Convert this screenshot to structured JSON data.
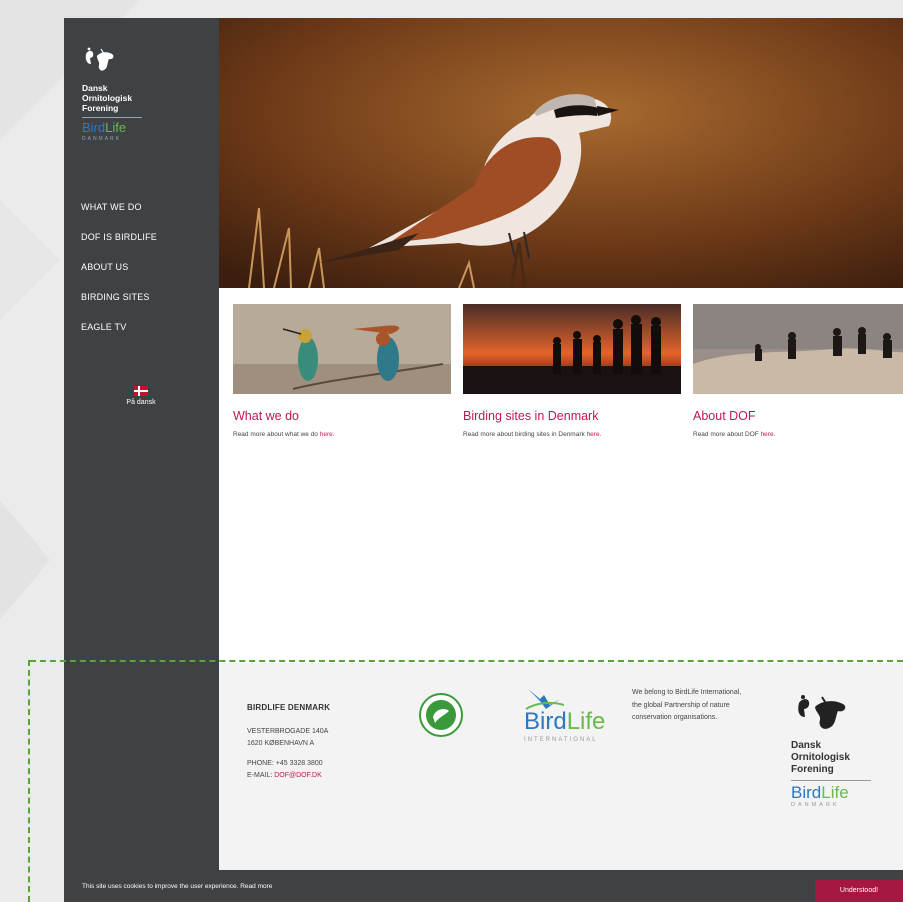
{
  "sidebar": {
    "logo": {
      "org_line1": "Dansk",
      "org_line2": "Ornitologisk",
      "org_line3": "Forening",
      "birdlife_a": "Bird",
      "birdlife_b": "Life",
      "birdlife_sub": "DANMARK"
    },
    "nav": [
      {
        "label": "WHAT WE DO"
      },
      {
        "label": "DOF IS BIRDLIFE"
      },
      {
        "label": "ABOUT US"
      },
      {
        "label": "BIRDING SITES"
      },
      {
        "label": "EAGLE TV"
      }
    ],
    "language": {
      "label": "På dansk",
      "icon": "danish-flag-icon"
    }
  },
  "hero": {
    "image": "red-backed-shrike-photo"
  },
  "cards": [
    {
      "title": "What we do",
      "text": "Read more about what we do ",
      "link": "here.",
      "image": "bee-eaters-photo"
    },
    {
      "title": "Birding sites in Denmark",
      "text": "Read more about birding sites in Denmark ",
      "link": "here.",
      "image": "birders-sunset-photo"
    },
    {
      "title": "About DOF",
      "text": "Read more about DOF ",
      "link": "here.",
      "image": "birders-dunes-photo"
    }
  ],
  "footer": {
    "heading": "BIRDLIFE DENMARK",
    "address1": "VESTERBROGADE 140A",
    "address2": "1620 KØBENHAVN A",
    "phone": "PHONE: +45 3328 3800",
    "email_label": "E-MAIL: ",
    "email": "DOF@DOF.DK",
    "birdlife_intl_a": "Bird",
    "birdlife_intl_b": "Life",
    "birdlife_intl_sub": "INTERNATIONAL",
    "belong_text": "We belong to BirdLife International, the global Partnership of nature conservation organisations.",
    "dof_line1": "Dansk",
    "dof_line2": "Ornitologisk",
    "dof_line3": "Forening",
    "dof_bl_a": "Bird",
    "dof_bl_b": "Life",
    "dof_sub": "DANMARK"
  },
  "cookie": {
    "text": "This site uses cookies to improve the user experience. Read more",
    "button": "Understood!"
  },
  "colors": {
    "accent": "#c0184f",
    "sidebar": "#3e4245",
    "cookie_button": "#a51640"
  }
}
